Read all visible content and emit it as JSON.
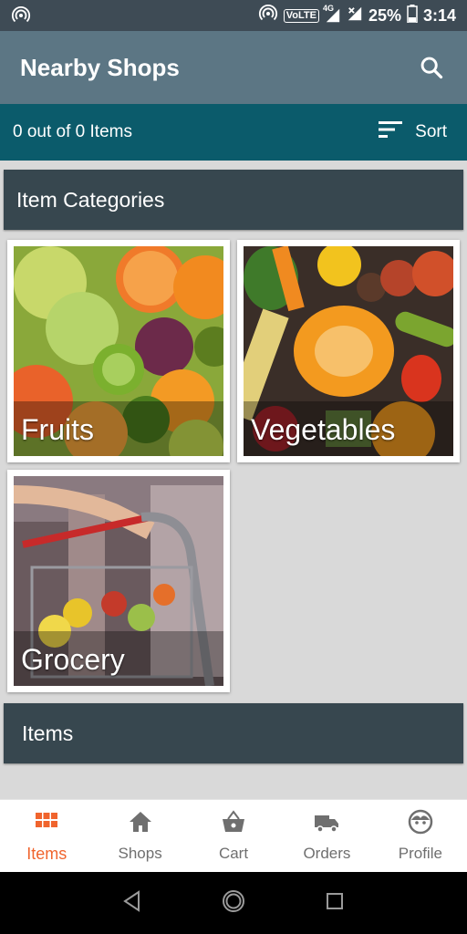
{
  "status_bar": {
    "battery": "25%",
    "time": "3:14",
    "network": "VoLTE",
    "net_gen": "4G"
  },
  "app_bar": {
    "title": "Nearby Shops",
    "search_icon": "search-icon"
  },
  "sub_bar": {
    "item_count": "0 out of 0 Items",
    "sort_label": "Sort"
  },
  "sections": {
    "categories_title": "Item Categories",
    "items_title": "Items"
  },
  "categories": [
    {
      "label": "Fruits"
    },
    {
      "label": "Vegetables"
    },
    {
      "label": "Grocery"
    }
  ],
  "bottom_nav": [
    {
      "label": "Items",
      "icon": "grid-icon",
      "active": true
    },
    {
      "label": "Shops",
      "icon": "home-icon",
      "active": false
    },
    {
      "label": "Cart",
      "icon": "basket-icon",
      "active": false
    },
    {
      "label": "Orders",
      "icon": "truck-icon",
      "active": false
    },
    {
      "label": "Profile",
      "icon": "face-icon",
      "active": false
    }
  ],
  "colors": {
    "status_bar": "#3e4b55",
    "app_bar": "#5c7684",
    "sub_bar": "#0b5b6b",
    "section_header": "#37474f",
    "accent": "#f0642d"
  }
}
